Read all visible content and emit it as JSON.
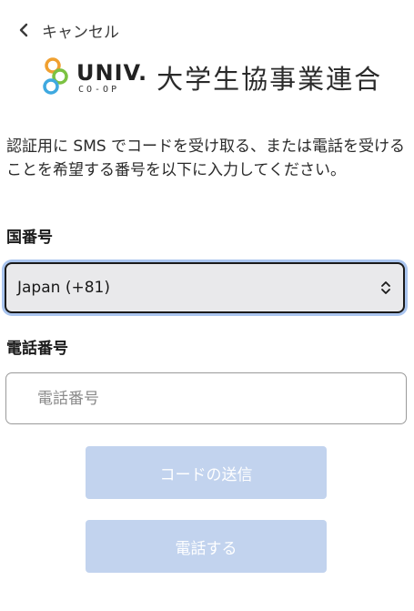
{
  "nav": {
    "cancel_label": "キャンセル"
  },
  "logo": {
    "brand_main": "UNIV.",
    "brand_sub": "CO-OP",
    "org_name": "大学生協事業連合"
  },
  "description": "認証用に SMS でコードを受け取る、または電話を受けることを希望する番号を以下に入力してください。",
  "country": {
    "label": "国番号",
    "selected": "Japan (+81)"
  },
  "phone": {
    "label": "電話番号",
    "placeholder": "電話番号"
  },
  "buttons": {
    "send_code": "コードの送信",
    "call": "電話する"
  },
  "colors": {
    "button_disabled_bg": "#c2d3ee",
    "focus_ring": "#a9c4ee",
    "select_bg": "#e9e9eb",
    "logo_orange": "#f0a030",
    "logo_green": "#7cc242",
    "logo_blue": "#3fa9e0"
  }
}
